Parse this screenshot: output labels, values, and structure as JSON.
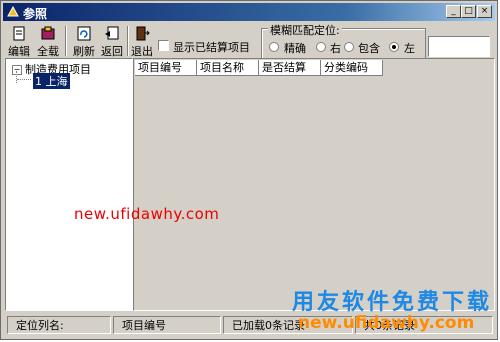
{
  "window": {
    "title": "参照",
    "controls": {
      "minimize": "_",
      "maximize": "□",
      "close": "×"
    }
  },
  "toolbar": {
    "edit_label": "编辑",
    "select_all_label": "全载",
    "refresh_label": "刷新",
    "back_label": "返回",
    "exit_label": "退出",
    "show_settled_label": "显示已结算项目",
    "match_group_title": "模糊匹配定位:",
    "match_options": {
      "exact": "精确",
      "right": "右",
      "contains": "包含",
      "left": "左"
    },
    "selected_match": "left",
    "search_value": ""
  },
  "tree": {
    "root_label": "制造费用项目",
    "expander": "⊟",
    "child_label": "1 上海"
  },
  "list": {
    "columns": [
      "项目编号",
      "项目名称",
      "是否结算",
      "分类编码"
    ],
    "rows": []
  },
  "statusbar": {
    "locate_label": "定位列名:",
    "locate_column": "项目编号",
    "loaded_text": "已加载0条记录",
    "total_text": "共0条记录"
  },
  "watermarks": {
    "url_red": "new.ufidawhy.com",
    "brand_blue": "用友软件免费下载",
    "url_orange": "new.ufidawhy.com"
  },
  "colors": {
    "titlebar": "#0a246a",
    "selection": "#0a246a",
    "watermark_red": "#e00000",
    "watermark_blue": "#1e88e5",
    "watermark_orange": "#ff8c00"
  }
}
